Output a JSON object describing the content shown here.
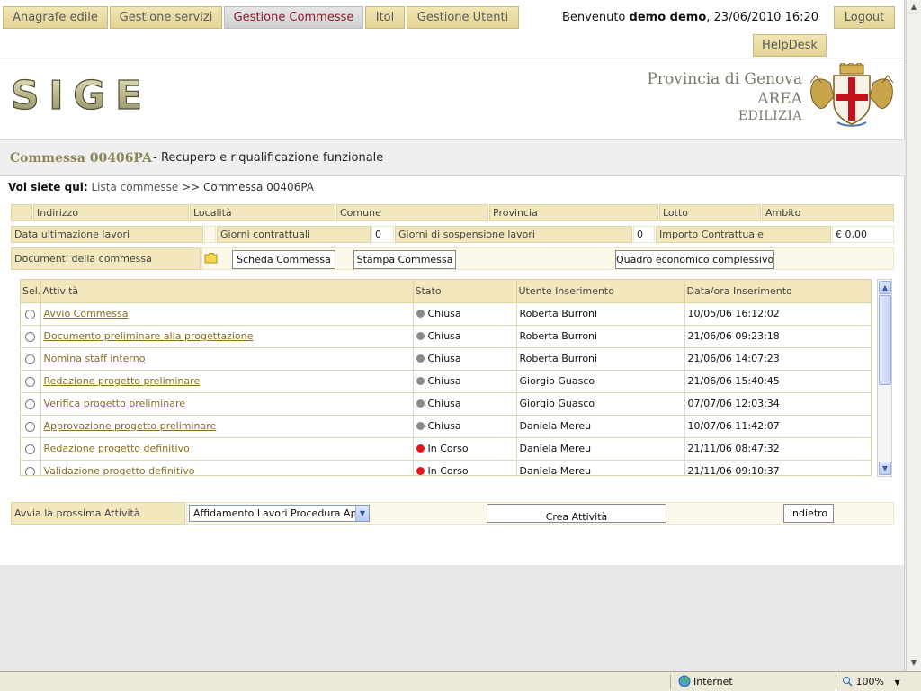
{
  "nav": {
    "tabs": [
      {
        "label": "Anagrafe edile",
        "active": false
      },
      {
        "label": "Gestione servizi",
        "active": false
      },
      {
        "label": "Gestione Commesse",
        "active": true
      },
      {
        "label": "Itol",
        "active": false
      },
      {
        "label": "Gestione Utenti",
        "active": false
      }
    ],
    "welcome_prefix": "Benvenuto",
    "user_name": "demo demo",
    "welcome_suffix": ", 23/06/2010 16:20",
    "logout_label": "Logout",
    "helpdesk_label": "HelpDesk"
  },
  "header": {
    "logo_text": "SIGE",
    "province_line1": "Provincia di Genova",
    "province_line2": "AREA",
    "province_line3": "EDILIZIA"
  },
  "commessa": {
    "code": "Commessa 00406PA",
    "separator": " - ",
    "description": "Recupero e riqualificazione funzionale"
  },
  "breadcrumb": {
    "prefix": "Voi siete qui:",
    "link": "Lista commesse",
    "sep": ">>",
    "current": "Commessa 00406PA"
  },
  "fields": {
    "row1": [
      "",
      "Indirizzo",
      "Località",
      "Comune",
      "Provincia",
      "Lotto",
      "Ambito"
    ],
    "data_ultimazione_label": "Data ultimazione lavori",
    "data_ultimazione_value": "",
    "giorni_contrattuali_label": "Giorni contrattuali",
    "giorni_contrattuali_value": "0",
    "giorni_sospensione_label": "Giorni di sospensione lavori",
    "giorni_sospensione_value": "0",
    "importo_label": "Importo Contrattuale",
    "importo_value": "€ 0,00",
    "documenti_label": "Documenti della commessa",
    "scheda_button": "Scheda Commessa",
    "stampa_button": "Stampa Commessa",
    "quadro_button": "Quadro economico complessivo"
  },
  "table": {
    "headers": [
      "Sel.",
      "Attività",
      "Stato",
      "Utente Inserimento",
      "Data/ora Inserimento"
    ],
    "rows": [
      {
        "activity": "Avvio Commessa",
        "status": "Chiusa",
        "status_color": "#8a8a8a",
        "user": "Roberta Burroni",
        "datetime": "10/05/06 16:12:02"
      },
      {
        "activity": "Documento preliminare alla progettazione",
        "status": "Chiusa",
        "status_color": "#8a8a8a",
        "user": "Roberta Burroni",
        "datetime": "21/06/06 09:23:18"
      },
      {
        "activity": "Nomina staff interno",
        "status": "Chiusa",
        "status_color": "#8a8a8a",
        "user": "Roberta Burroni",
        "datetime": "21/06/06 14:07:23"
      },
      {
        "activity": "Redazione progetto preliminare",
        "status": "Chiusa",
        "status_color": "#8a8a8a",
        "user": "Giorgio Guasco",
        "datetime": "21/06/06 15:40:45"
      },
      {
        "activity": "Verifica progetto preliminare",
        "status": "Chiusa",
        "status_color": "#8a8a8a",
        "user": "Giorgio Guasco",
        "datetime": "07/07/06 12:03:34"
      },
      {
        "activity": "Approvazione progetto preliminare",
        "status": "Chiusa",
        "status_color": "#8a8a8a",
        "user": "Daniela Mereu",
        "datetime": "10/07/06 11:42:07"
      },
      {
        "activity": "Redazione progetto definitivo",
        "status": "In Corso",
        "status_color": "#e8141c",
        "user": "Daniela Mereu",
        "datetime": "21/11/06 08:47:32"
      },
      {
        "activity": "Validazione progetto definitivo",
        "status": "In Corso",
        "status_color": "#e8141c",
        "user": "Daniela Mereu",
        "datetime": "21/11/06 09:10:37"
      }
    ]
  },
  "next_activity": {
    "label": "Avvia la prossima Attività",
    "selected": "Affidamento Lavori Procedura Aperta",
    "create_button": "Crea Attività",
    "back_button": "Indietro"
  },
  "statusbar": {
    "zone": "Internet",
    "zoom": "100%"
  },
  "colors": {
    "accent_gold": "#f3e8bd",
    "active_tab_text": "#8b1d2c",
    "link": "#8a6d20"
  }
}
